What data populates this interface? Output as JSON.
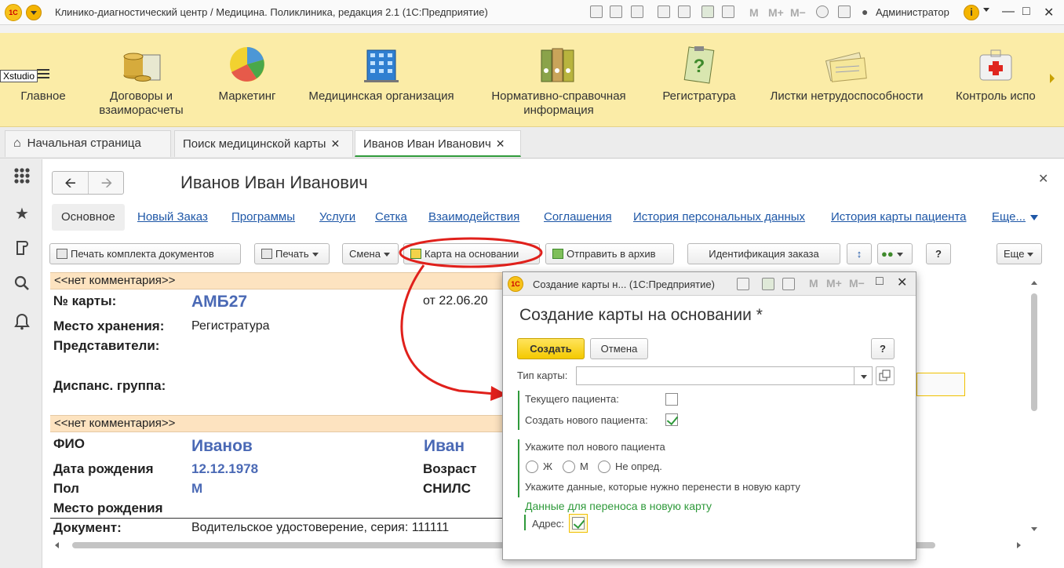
{
  "window": {
    "title": "Клинико-диагностический центр / Медицина. Поликлиника, редакция 2.1  (1С:Предприятие)",
    "user": "Администратор",
    "memory_buttons": [
      "M",
      "M+",
      "M−"
    ]
  },
  "sections": [
    {
      "label": "Главное",
      "icon": "menu-icon"
    },
    {
      "label": "Договоры и взаиморасчеты",
      "icon": "coins-icon"
    },
    {
      "label": "Маркетинг",
      "icon": "pie-chart-icon"
    },
    {
      "label": "Медицинская организация",
      "icon": "building-icon"
    },
    {
      "label": "Нормативно-справочная информация",
      "icon": "binders-icon"
    },
    {
      "label": "Регистратура",
      "icon": "clipboard-question-icon"
    },
    {
      "label": "Листки нетрудоспособности",
      "icon": "documents-icon"
    },
    {
      "label": "Контроль испо",
      "icon": "first-aid-icon"
    }
  ],
  "overlay_label": "Xstudio",
  "tabs": [
    {
      "label": "Начальная страница"
    },
    {
      "label": "Поиск медицинской карты"
    },
    {
      "label": "Иванов Иван Иванович"
    }
  ],
  "page": {
    "title": "Иванов Иван Иванович",
    "link_tabs": [
      "Основное",
      "Новый Заказ",
      "Программы",
      "Услуги",
      "Сетка",
      "Взаимодействия",
      "Соглашения",
      "История персональных данных",
      "История карты пациента",
      "Еще..."
    ],
    "toolbar": {
      "print_set": "Печать комплекта документов",
      "print": "Печать",
      "change": "Смена",
      "card_based_on": "Карта на основании",
      "send_archive": "Отправить в архив",
      "order_identification": "Идентификация заказа",
      "help": "?",
      "more": "Еще"
    }
  },
  "card": {
    "comment_1": "<<нет комментария>>",
    "comment_2": "<<нет комментария>>",
    "card_number_label": "№ карты:",
    "card_number": "АМБ27",
    "card_date": "от 22.06.20",
    "storage_label": "Место хранения:",
    "storage": "Регистратура",
    "representatives_label": "Представители:",
    "dispensary_label": "Диспанс. группа:",
    "fio_label": "ФИО",
    "last_name": "Иванов",
    "first_name": "Иван",
    "birth_date_label": "Дата рождения",
    "birth_date": "12.12.1978",
    "age_label": "Возраст",
    "sex_label": "Пол",
    "sex": "М",
    "snils_label": "СНИЛС",
    "birthplace_label": "Место рождения",
    "document_label": "Документ:",
    "document": "Водительское удостоверение, серия: 111111"
  },
  "dialog": {
    "window_title": "Создание карты н...  (1С:Предприятие)",
    "heading": "Создание карты на основании *",
    "create_button": "Создать",
    "cancel_button": "Отмена",
    "help_button": "?",
    "card_type_label": "Тип карты:",
    "card_type_value": "",
    "current_patient_label": "Текущего пациента:",
    "current_patient_checked": false,
    "new_patient_label": "Создать нового пациента:",
    "new_patient_checked": true,
    "sex_prompt": "Укажите пол нового пациента",
    "sex_options": [
      "Ж",
      "М",
      "Не опред."
    ],
    "transfer_prompt": "Укажите данные, которые нужно перенести в новую карту",
    "transfer_group": "Данные для переноса в новую карту",
    "address_label": "Адрес:",
    "address_checked": true
  },
  "colors": {
    "section_panel": "#fbeca7",
    "accent_green": "#2f9a3b",
    "link_blue": "#1e57a7",
    "value_blue": "#4a69b5",
    "comment_bar": "#fde3c0",
    "primary_button": "#f4c900",
    "annotation_red": "#e0201b"
  }
}
